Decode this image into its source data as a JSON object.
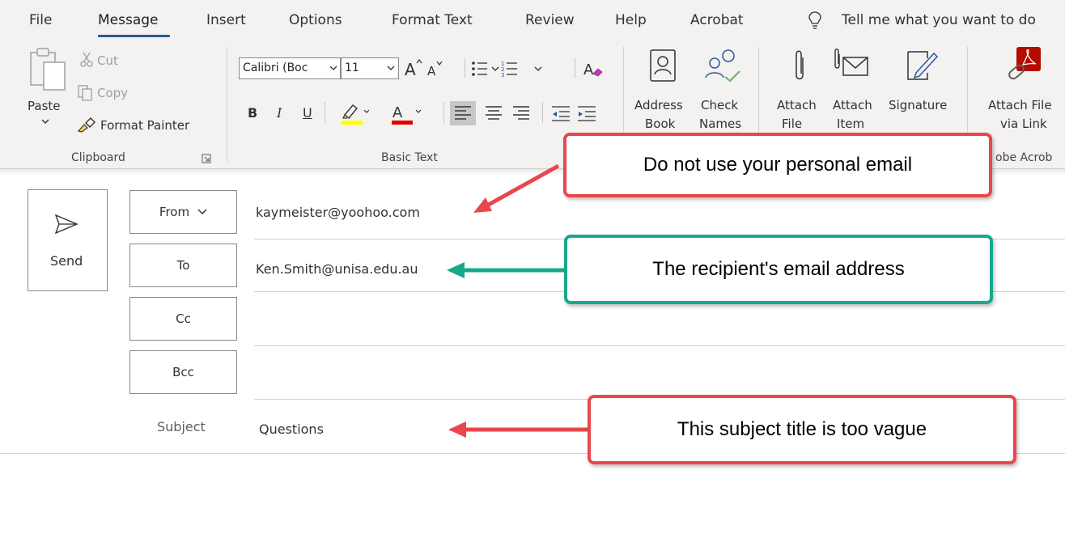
{
  "tabs": {
    "file": "File",
    "message": "Message",
    "insert": "Insert",
    "options": "Options",
    "format_text": "Format Text",
    "review": "Review",
    "help": "Help",
    "acrobat": "Acrobat",
    "tell_me": "Tell me what you want to do"
  },
  "clipboard": {
    "paste": "Paste",
    "cut": "Cut",
    "copy": "Copy",
    "format_painter": "Format Painter",
    "group_label": "Clipboard"
  },
  "basic_text": {
    "font_name": "Calibri (Boc",
    "font_size": "11",
    "bold": "B",
    "italic": "I",
    "underline": "U",
    "group_label": "Basic Text",
    "highlight_color": "#ffff00",
    "font_color": "#e00000"
  },
  "names": {
    "address_book_line1": "Address",
    "address_book_line2": "Book",
    "check_names_line1": "Check",
    "check_names_line2": "Names"
  },
  "include": {
    "attach_file_line1": "Attach",
    "attach_file_line2": "File",
    "attach_item_line1": "Attach",
    "attach_item_line2": "Item",
    "signature_line1": "Signature"
  },
  "adobe": {
    "attach_link_line1": "Attach File",
    "attach_link_line2": "via Link",
    "group_label": "obe Acrob"
  },
  "compose": {
    "send_label": "Send",
    "from_label": "From",
    "to_label": "To",
    "cc_label": "Cc",
    "bcc_label": "Bcc",
    "subject_label": "Subject",
    "from_value": "kaymeister@yoohoo.com",
    "to_value": "Ken.Smith@unisa.edu.au",
    "cc_value": "",
    "bcc_value": "",
    "subject_value": "Questions"
  },
  "callouts": {
    "from_note": "Do not use your personal email",
    "to_note": "The recipient's email address",
    "subject_note": "This subject title is too vague"
  },
  "colors": {
    "accent": "#2b579a",
    "callout_red": "#e8474c",
    "callout_teal": "#17a98b"
  }
}
